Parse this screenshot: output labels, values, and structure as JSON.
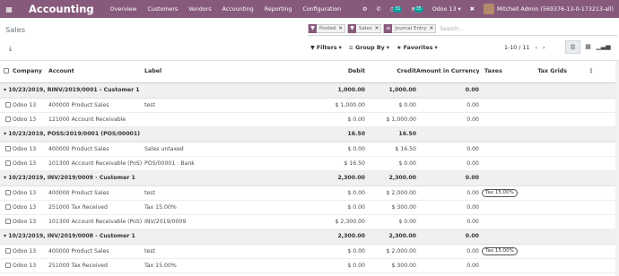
{
  "navbar": {
    "apps_icon": "apps-grid-icon",
    "brand": "Accounting",
    "menu": [
      "Overview",
      "Customers",
      "Vendors",
      "Accounting",
      "Reporting",
      "Configuration"
    ],
    "activity_count": "31",
    "messages_count": "35",
    "company": "Odoo 13",
    "user": "Mitchell Admin (569376-13-0-173213-all)"
  },
  "control_panel": {
    "breadcrumb": "Sales",
    "facets": [
      {
        "icon": "filter-icon",
        "label": "Posted"
      },
      {
        "icon": "filter-icon",
        "label": "Sales"
      },
      {
        "icon": "group-icon",
        "label": "Journal Entry"
      }
    ],
    "search_placeholder": "Search...",
    "filters_label": "Filters",
    "groupby_label": "Group By",
    "favorites_label": "Favorites",
    "pager": "1-10 / 11",
    "views": [
      "list-view-icon",
      "kanban-view-icon",
      "graph-view-icon"
    ]
  },
  "table": {
    "columns": [
      "Company",
      "Account",
      "Label",
      "Debit",
      "Credit",
      "Amount in Currency",
      "Taxes",
      "Tax Grids"
    ],
    "groups": [
      {
        "title": "10/23/2019, RINV/2019/0001 - Customer 1",
        "debit": "1,000.00",
        "credit": "1,000.00",
        "amount": "0.00",
        "lines": [
          {
            "company": "Odoo 13",
            "account": "400000 Product Sales",
            "label": "test",
            "debit": "$ 1,000.00",
            "credit": "$ 0.00",
            "amount": "0.00",
            "tax": ""
          },
          {
            "company": "Odoo 13",
            "account": "121000 Account Receivable",
            "label": "",
            "debit": "$ 0.00",
            "credit": "$ 1,000.00",
            "amount": "0.00",
            "tax": ""
          }
        ]
      },
      {
        "title": "10/23/2019, POSS/2019/0001    (POS/00001)",
        "debit": "16.50",
        "credit": "16.50",
        "amount": "",
        "lines": [
          {
            "company": "Odoo 13",
            "account": "400000 Product Sales",
            "label": "Sales untaxed",
            "debit": "$ 0.00",
            "credit": "$ 16.50",
            "amount": "0.00",
            "tax": ""
          },
          {
            "company": "Odoo 13",
            "account": "101300 Account Receivable (PoS)",
            "label": "POS/00001 : Bank",
            "debit": "$ 16.50",
            "credit": "$ 0.00",
            "amount": "0.00",
            "tax": ""
          }
        ]
      },
      {
        "title": "10/23/2019, INV/2019/0009 - Customer 1",
        "debit": "2,300.00",
        "credit": "2,300.00",
        "amount": "0.00",
        "lines": [
          {
            "company": "Odoo 13",
            "account": "400000 Product Sales",
            "label": "test",
            "debit": "$ 0.00",
            "credit": "$ 2,000.00",
            "amount": "0.00",
            "tax": "Tax 15.00%"
          },
          {
            "company": "Odoo 13",
            "account": "251000 Tax Received",
            "label": "Tax 15.00%",
            "debit": "$ 0.00",
            "credit": "$ 300.00",
            "amount": "0.00",
            "tax": ""
          },
          {
            "company": "Odoo 13",
            "account": "101300 Account Receivable (PoS)",
            "label": "INV/2019/0009",
            "debit": "$ 2,300.00",
            "credit": "$ 0.00",
            "amount": "0.00",
            "tax": ""
          }
        ]
      },
      {
        "title": "10/23/2019, INV/2019/0008 - Customer 1",
        "debit": "2,300.00",
        "credit": "2,300.00",
        "amount": "0.00",
        "lines": [
          {
            "company": "Odoo 13",
            "account": "400000 Product Sales",
            "label": "test",
            "debit": "$ 0.00",
            "credit": "$ 2,000.00",
            "amount": "0.00",
            "tax": "Tax 15.00%"
          },
          {
            "company": "Odoo 13",
            "account": "251000 Tax Received",
            "label": "Tax 15.00%",
            "debit": "$ 0.00",
            "credit": "$ 300.00",
            "amount": "0.00",
            "tax": ""
          }
        ]
      }
    ]
  }
}
